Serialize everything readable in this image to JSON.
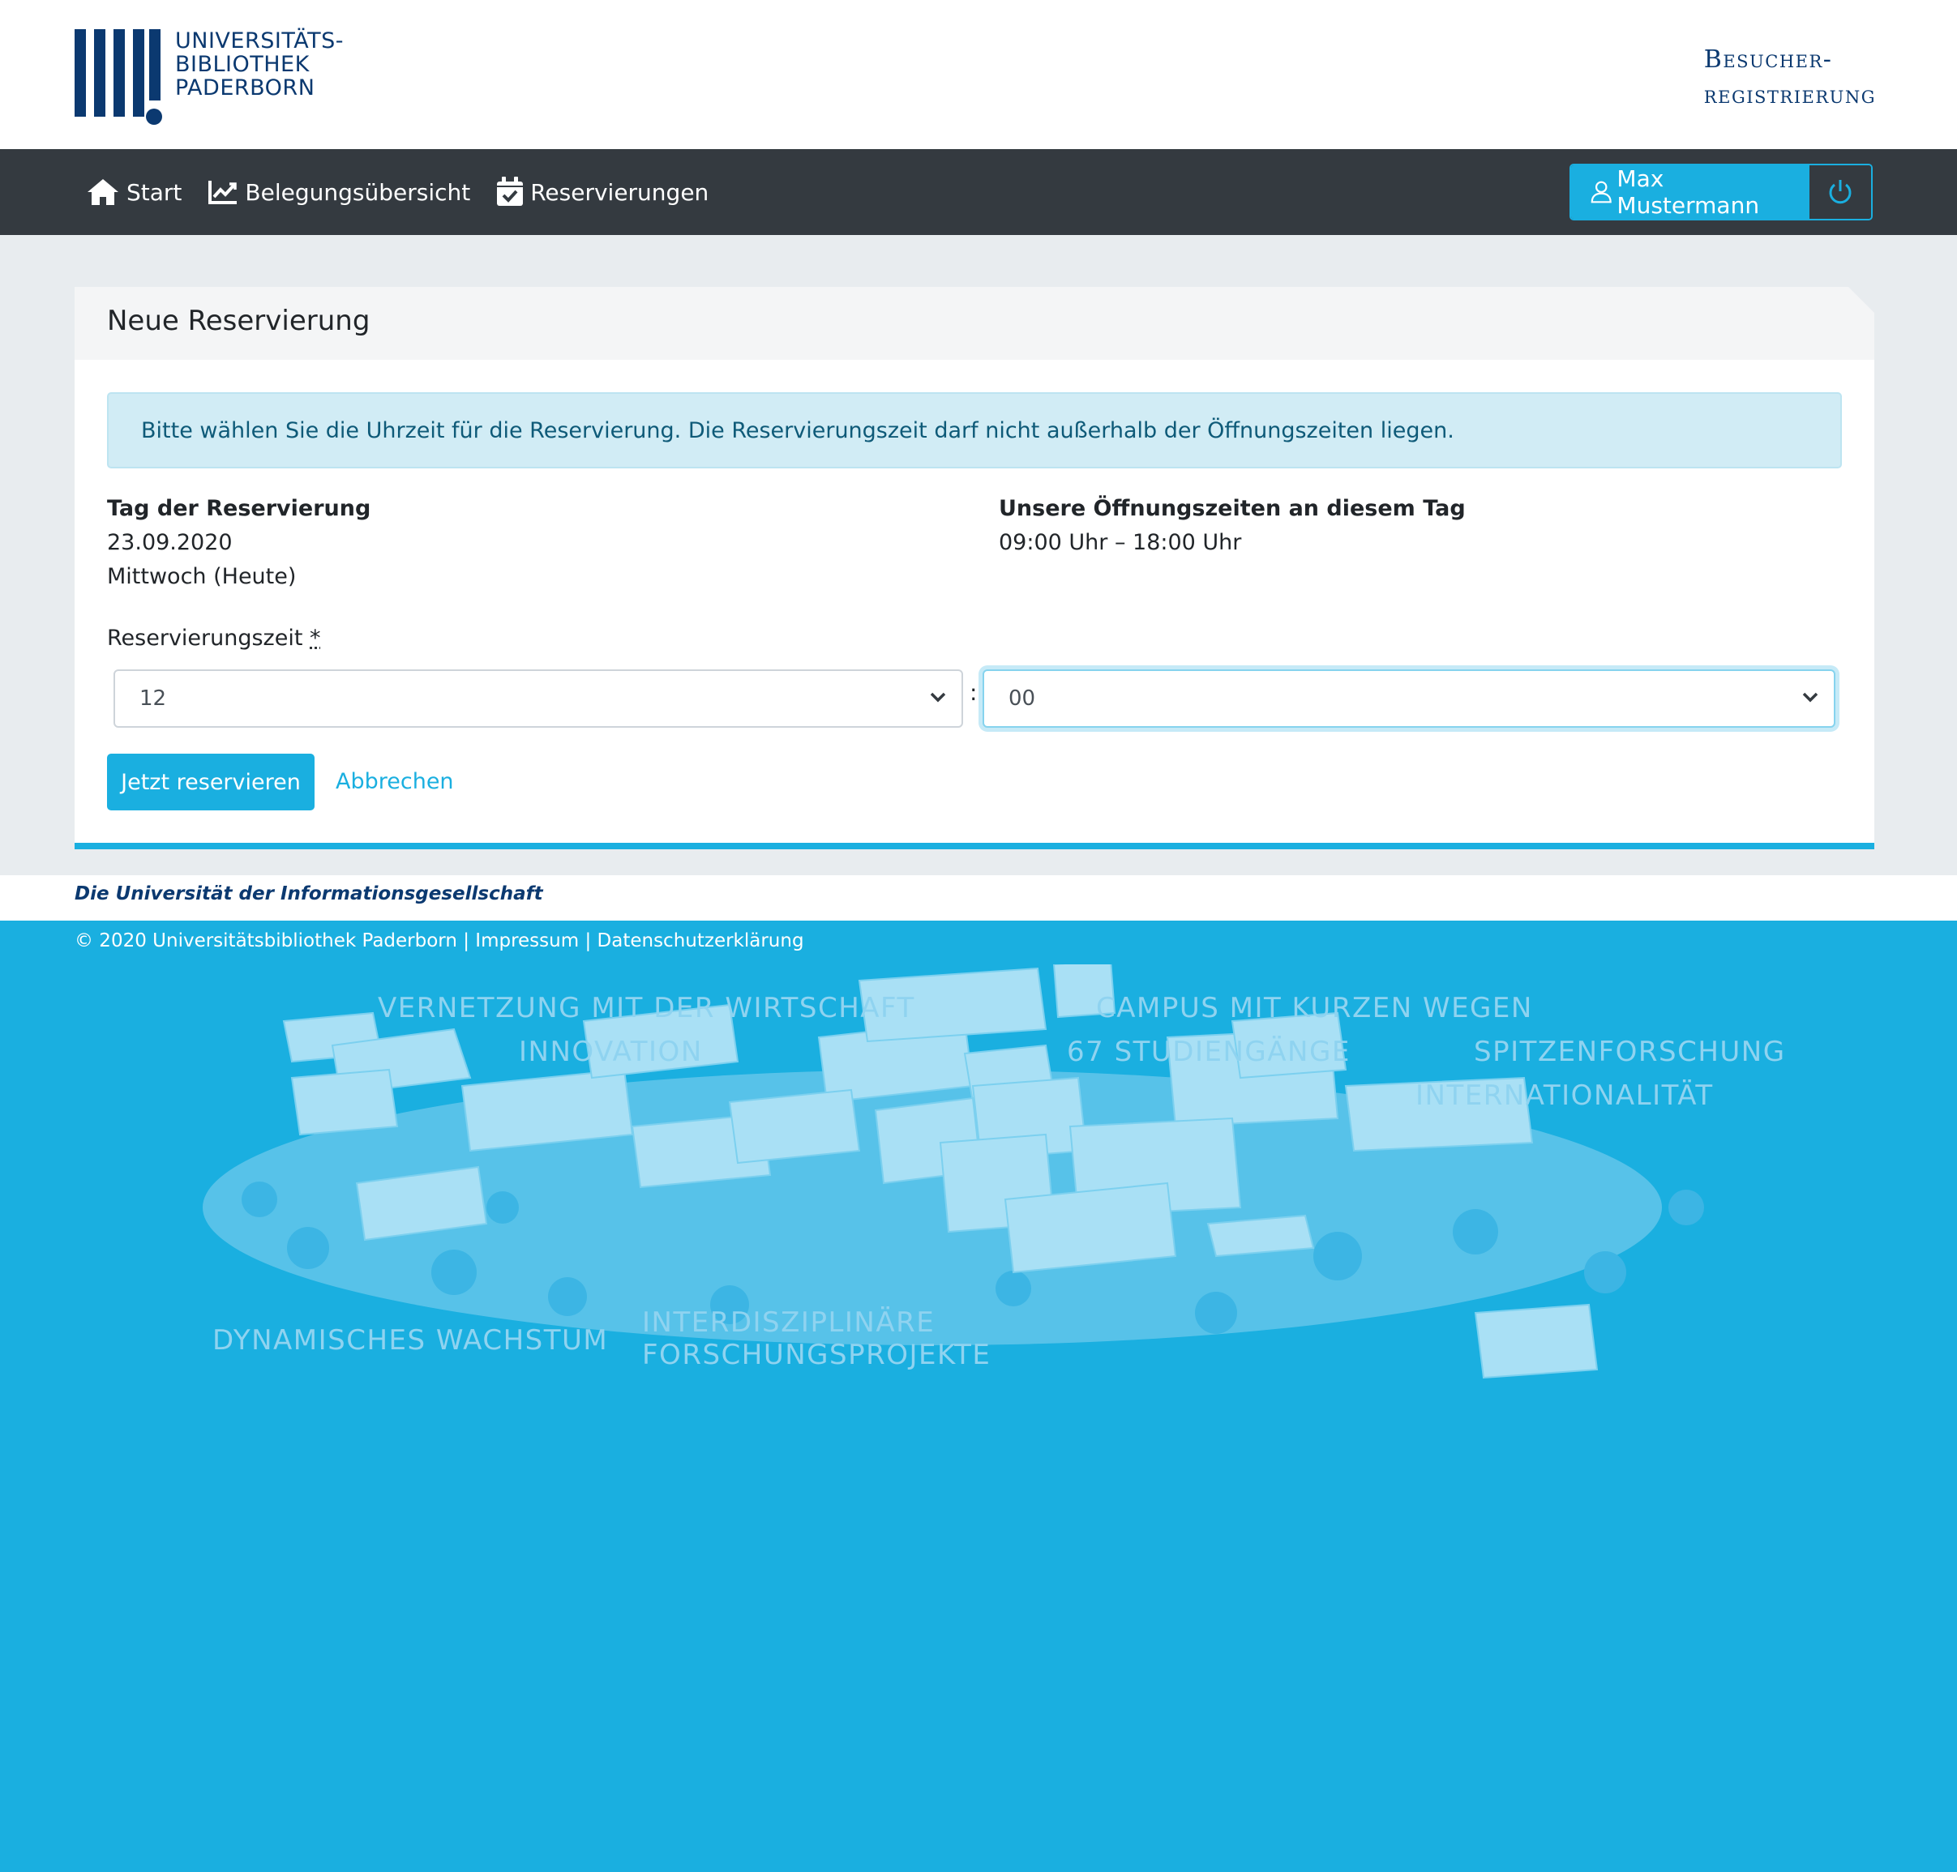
{
  "header": {
    "logo_lines": [
      "UNIVERSITÄTS-",
      "BIBLIOTHEK",
      "PADERBORN"
    ],
    "brand_lines": [
      "Besucher-",
      "registrierung"
    ]
  },
  "nav": {
    "items": [
      {
        "label": "Start",
        "icon": "home-icon"
      },
      {
        "label": "Belegungsübersicht",
        "icon": "chart-line-icon"
      },
      {
        "label": "Reservierungen",
        "icon": "calendar-check-icon"
      }
    ],
    "user_label": "Max Mustermann",
    "user_icon": "user-icon",
    "logout_icon": "power-icon"
  },
  "card": {
    "title": "Neue Reservierung",
    "alert": "Bitte wählen Sie die Uhrzeit für die Reservierung. Die Reservierungszeit darf nicht außerhalb der Öffnungszeiten liegen.",
    "day_label": "Tag der Reservierung",
    "day_date": "23.09.2020",
    "day_weekday": "Mittwoch (Heute)",
    "hours_label": "Unsere Öffnungszeiten an diesem Tag",
    "hours_value": "09:00 Uhr – 18:00 Uhr",
    "time_label": "Reservierungszeit",
    "required_mark": "*",
    "hour_value": "12",
    "separator": ":",
    "minute_value": "00",
    "submit_label": "Jetzt reservieren",
    "cancel_label": "Abbrechen"
  },
  "footer": {
    "tagline": "Die Universität der Informationsgesellschaft",
    "copyright": "© 2020 Universitätsbibliothek Paderborn",
    "sep": "|",
    "impressum": "Impressum",
    "privacy": "Datenschutzerklärung",
    "campus_words": [
      "VERNETZUNG MIT DER WIRTSCHAFT",
      "INNOVATION",
      "CAMPUS MIT KURZEN WEGEN",
      "67 STUDIENGÄNGE",
      "SPITZENFORSCHUNG",
      "INTERNATIONALITÄT",
      "DYNAMISCHES WACHSTUM",
      "INTERDISZIPLINÄRE",
      "FORSCHUNGSPROJEKTE"
    ]
  },
  "colors": {
    "brand_dark": "#0b3970",
    "accent": "#1aafe0",
    "navbar": "#343a40"
  }
}
